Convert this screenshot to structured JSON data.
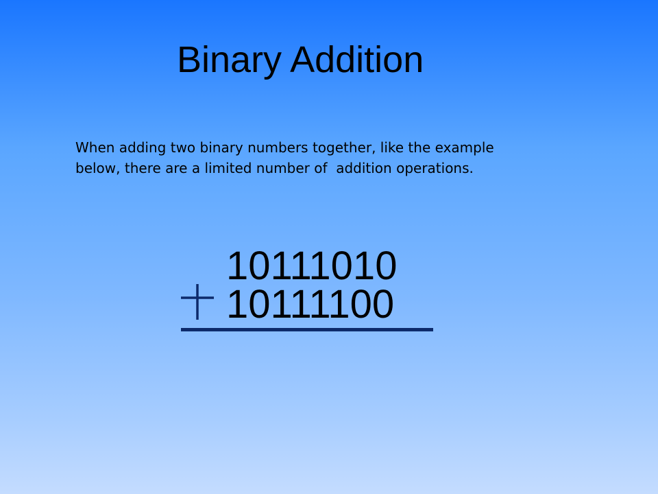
{
  "slide": {
    "title": "Binary Addition",
    "body_lines": [
      "When adding two binary numbers together, like the example",
      "below, there are a limited number of  addition operations."
    ],
    "addition": {
      "operand_1": "10111010",
      "operand_2": "10111100"
    },
    "colors": {
      "background_top": "#1a76ff",
      "background_bottom": "#c4dcff",
      "plus_and_line": "#0d2a6b"
    },
    "icons": {
      "plus": "plus-icon"
    }
  }
}
